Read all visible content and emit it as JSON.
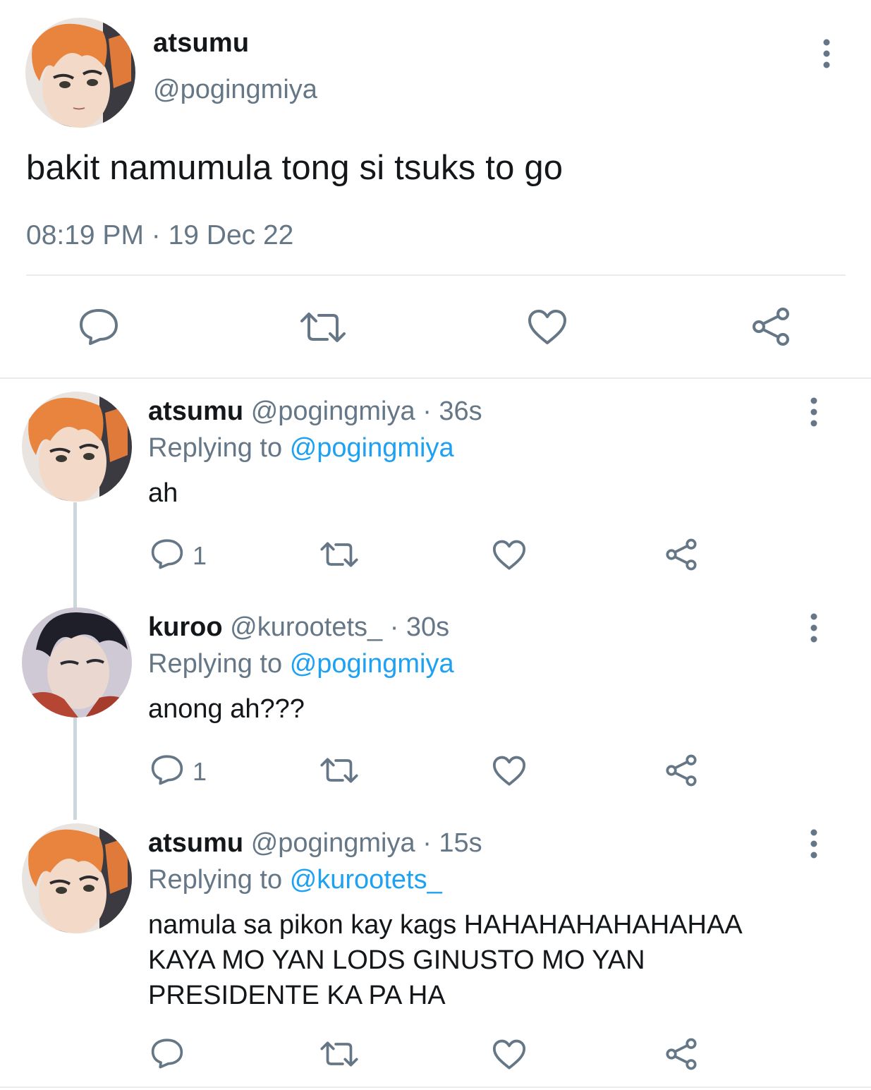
{
  "main_tweet": {
    "display_name": "atsumu",
    "handle": "@pogingmiya",
    "text": "bakit namumula tong si tsuks to go",
    "timestamp": "08:19 PM · 19 Dec 22",
    "avatar": "atsumu-avatar",
    "actions": [
      "reply-icon",
      "retweet-icon",
      "like-icon",
      "share-icon"
    ]
  },
  "replies": [
    {
      "display_name": "atsumu",
      "handle": "@pogingmiya",
      "time": "· 36s",
      "replying_prefix": "Replying to",
      "replying_to": "@pogingmiya",
      "text": "ah",
      "reply_count": "1",
      "avatar": "atsumu-avatar"
    },
    {
      "display_name": "kuroo",
      "handle": "@kurootets_",
      "time": "· 30s",
      "replying_prefix": "Replying to",
      "replying_to": "@pogingmiya",
      "text": "anong ah???",
      "reply_count": "1",
      "avatar": "kuroo-avatar"
    },
    {
      "display_name": "atsumu",
      "handle": "@pogingmiya",
      "time": "· 15s",
      "replying_prefix": "Replying to",
      "replying_to": "@kurootets_",
      "text_lines": [
        "namula sa pikon kay kags HAHAHAHAHAHAHAA",
        "KAYA MO YAN LODS GINUSTO MO YAN",
        "PRESIDENTE KA PA HA"
      ],
      "avatar": "atsumu-avatar"
    }
  ],
  "colors": {
    "primary_text": "#14171a",
    "secondary_text": "#657786",
    "link": "#1da1f2",
    "divider": "#e6ecf0",
    "thread_line": "#ccd6dd"
  }
}
